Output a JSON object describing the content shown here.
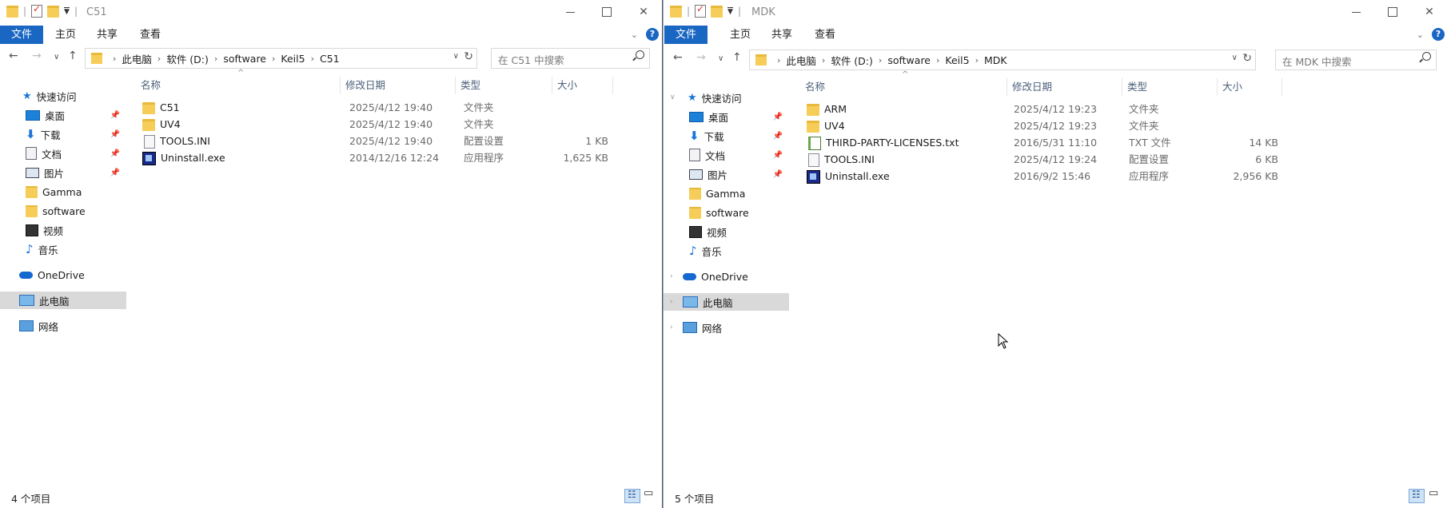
{
  "left_window": {
    "title": "C51",
    "ribbon": {
      "file": "文件",
      "home": "主页",
      "share": "共享",
      "view": "查看"
    },
    "breadcrumb": [
      "此电脑",
      "软件 (D:)",
      "software",
      "Keil5",
      "C51"
    ],
    "search_placeholder": "在 C51 中搜索",
    "nav": {
      "quick_access": "快速访问",
      "desktop": "桌面",
      "downloads": "下载",
      "documents": "文档",
      "pictures": "图片",
      "gamma": "Gamma",
      "software": "software",
      "videos": "视频",
      "music": "音乐",
      "onedrive": "OneDrive",
      "this_pc": "此电脑",
      "network": "网络"
    },
    "columns": {
      "name": "名称",
      "date": "修改日期",
      "type": "类型",
      "size": "大小"
    },
    "files": [
      {
        "name": "C51",
        "date": "2025/4/12 19:40",
        "type": "文件夹",
        "size": ""
      },
      {
        "name": "UV4",
        "date": "2025/4/12 19:40",
        "type": "文件夹",
        "size": ""
      },
      {
        "name": "TOOLS.INI",
        "date": "2025/4/12 19:40",
        "type": "配置设置",
        "size": "1 KB"
      },
      {
        "name": "Uninstall.exe",
        "date": "2014/12/16 12:24",
        "type": "应用程序",
        "size": "1,625 KB"
      }
    ],
    "status": "4 个项目"
  },
  "right_window": {
    "title": "MDK",
    "ribbon": {
      "file": "文件",
      "home": "主页",
      "share": "共享",
      "view": "查看"
    },
    "breadcrumb": [
      "此电脑",
      "软件 (D:)",
      "software",
      "Keil5",
      "MDK"
    ],
    "search_placeholder": "在 MDK 中搜索",
    "nav": {
      "quick_access": "快速访问",
      "desktop": "桌面",
      "downloads": "下载",
      "documents": "文档",
      "pictures": "图片",
      "gamma": "Gamma",
      "software": "software",
      "videos": "视频",
      "music": "音乐",
      "onedrive": "OneDrive",
      "this_pc": "此电脑",
      "network": "网络"
    },
    "columns": {
      "name": "名称",
      "date": "修改日期",
      "type": "类型",
      "size": "大小"
    },
    "files": [
      {
        "name": "ARM",
        "date": "2025/4/12 19:23",
        "type": "文件夹",
        "size": ""
      },
      {
        "name": "UV4",
        "date": "2025/4/12 19:23",
        "type": "文件夹",
        "size": ""
      },
      {
        "name": "THIRD-PARTY-LICENSES.txt",
        "date": "2016/5/31 11:10",
        "type": "TXT 文件",
        "size": "14 KB"
      },
      {
        "name": "TOOLS.INI",
        "date": "2025/4/12 19:24",
        "type": "配置设置",
        "size": "6 KB"
      },
      {
        "name": "Uninstall.exe",
        "date": "2016/9/2 15:46",
        "type": "应用程序",
        "size": "2,956 KB"
      }
    ],
    "status": "5 个项目"
  },
  "colors": {
    "accent": "#1a66c3",
    "selected_nav": "#d9d9d9",
    "folder": "#f6cd58"
  }
}
